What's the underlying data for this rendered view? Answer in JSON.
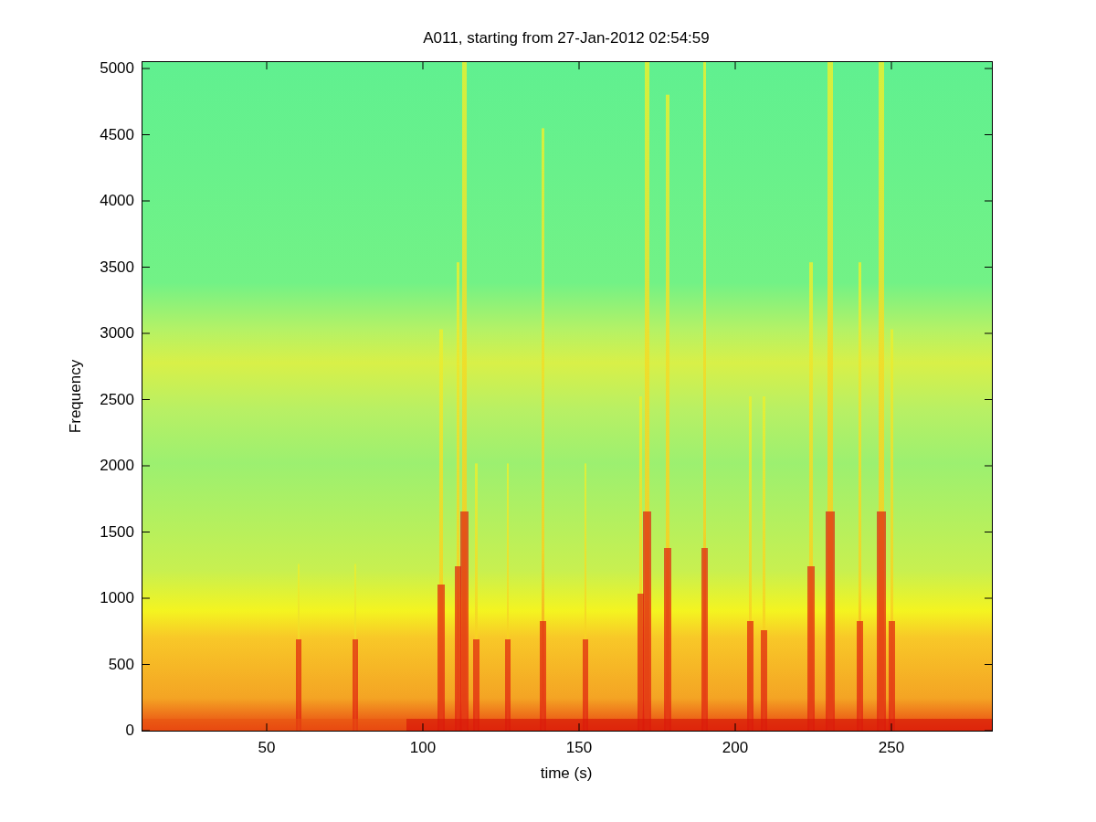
{
  "figure": {
    "title": "A011, starting from 27-Jan-2012 02:54:59",
    "xlabel": "time (s)",
    "ylabel": "Frequency",
    "xticks": [
      "50",
      "100",
      "150",
      "200",
      "250"
    ],
    "yticks": [
      "5000",
      "4500",
      "4000",
      "3500",
      "3000",
      "2500",
      "2000",
      "1500",
      "1000",
      "500",
      "0"
    ]
  }
}
